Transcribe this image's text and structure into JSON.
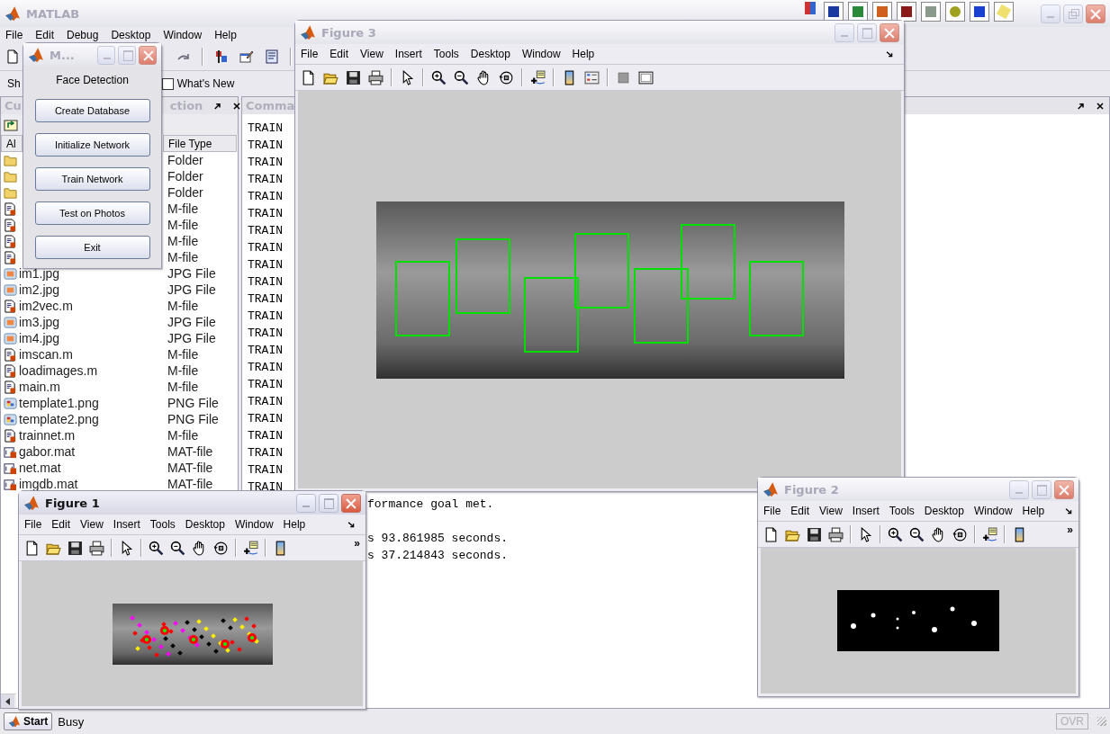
{
  "main_window": {
    "title": "MATLAB",
    "active": false,
    "menu": [
      "File",
      "Edit",
      "Debug",
      "Desktop",
      "Window",
      "Help"
    ],
    "shortcuts": [
      "Sh",
      "What's New"
    ]
  },
  "current_directory": {
    "title": "Cu",
    "title_end": "ction",
    "columns": [
      "Al",
      "File Type"
    ],
    "rows": [
      {
        "kind": "folder",
        "type": "Folder"
      },
      {
        "kind": "folder",
        "type": "Folder"
      },
      {
        "kind": "folder",
        "type": "Folder"
      },
      {
        "kind": "m-file",
        "type": "M-file"
      },
      {
        "kind": "m-file",
        "type": "M-file"
      },
      {
        "kind": "m-file",
        "type": "M-file"
      },
      {
        "kind": "m-file",
        "type": "M-file"
      },
      {
        "kind": "image",
        "name": "im1.jpg",
        "type": "JPG File"
      },
      {
        "kind": "image",
        "name": "im2.jpg",
        "type": "JPG File"
      },
      {
        "kind": "m-file",
        "name": "im2vec.m",
        "type": "M-file"
      },
      {
        "kind": "image",
        "name": "im3.jpg",
        "type": "JPG File"
      },
      {
        "kind": "image",
        "name": "im4.jpg",
        "type": "JPG File"
      },
      {
        "kind": "m-file",
        "name": "imscan.m",
        "type": "M-file"
      },
      {
        "kind": "m-file",
        "name": "loadimages.m",
        "type": "M-file"
      },
      {
        "kind": "m-file",
        "name": "main.m",
        "type": "M-file"
      },
      {
        "kind": "png",
        "name": "template1.png",
        "type": "PNG File"
      },
      {
        "kind": "png",
        "name": "template2.png",
        "type": "PNG File"
      },
      {
        "kind": "m-file",
        "name": "trainnet.m",
        "type": "M-file"
      },
      {
        "kind": "mat",
        "name": "gabor.mat",
        "type": "MAT-file"
      },
      {
        "kind": "mat",
        "name": "net.mat",
        "type": "MAT-file"
      },
      {
        "kind": "mat",
        "name": "imgdb.mat",
        "type": "MAT-file"
      }
    ]
  },
  "command_window": {
    "title": "Comma",
    "lines": [
      "TRAIN",
      "TRAIN",
      "TRAIN",
      "TRAIN",
      "TRAIN",
      "TRAIN",
      "TRAIN",
      "TRAIN",
      "TRAIN",
      "TRAIN",
      "TRAIN",
      "TRAIN",
      "TRAIN",
      "TRAIN",
      "TRAIN",
      "TRAIN",
      "TRAIN",
      "TRAIN",
      "TRAIN",
      "TRAIN",
      "TRAIN",
      "TRAIN"
    ],
    "output_blocks": [
      {
        "lines": [
          "formance goal met."
        ]
      },
      {
        "lines": [
          "s 93.861985 seconds.",
          "s 37.214843 seconds."
        ]
      }
    ]
  },
  "gui": {
    "title": "M...",
    "active": false,
    "heading": "Face Detection",
    "buttons": [
      "Create Database",
      "Initialize Network",
      "Train Network",
      "Test on Photos",
      "Exit"
    ]
  },
  "figures": [
    {
      "title": "Figure 3",
      "active": false,
      "kind": "detections",
      "extended_toolbar": true,
      "menu": [
        "File",
        "Edit",
        "View",
        "Insert",
        "Tools",
        "Desktop",
        "Window",
        "Help"
      ]
    },
    {
      "title": "Figure 1",
      "active": true,
      "kind": "markers",
      "extended_toolbar": false,
      "overflow": "»",
      "menu": [
        "File",
        "Edit",
        "View",
        "Insert",
        "Tools",
        "Desktop",
        "Window",
        "Help"
      ]
    },
    {
      "title": "Figure 2",
      "active": false,
      "kind": "mask",
      "extended_toolbar": false,
      "overflow": "»",
      "menu": [
        "File",
        "Edit",
        "View",
        "Insert",
        "Tools",
        "Desktop",
        "Window",
        "Help"
      ]
    }
  ],
  "status_bar": {
    "start": "Start",
    "status": "Busy",
    "mode": "OVR",
    "mode_enabled": false
  }
}
